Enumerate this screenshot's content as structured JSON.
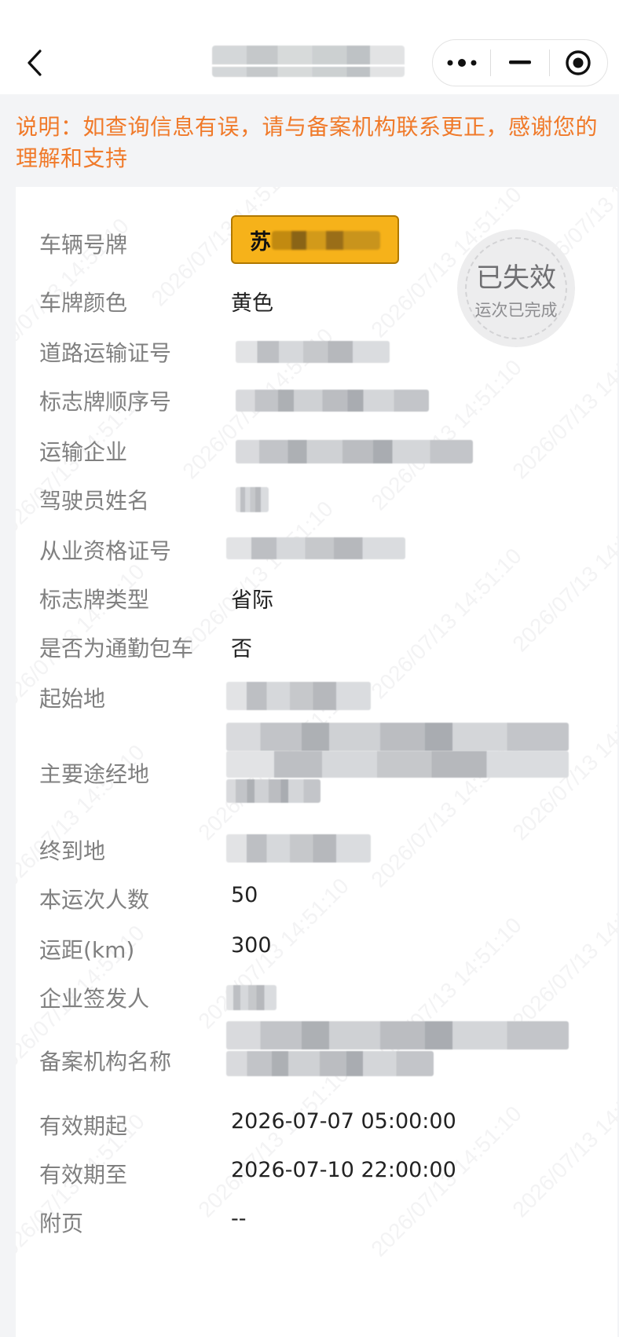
{
  "header": {
    "back_icon": "chevron-left-icon",
    "capsule": {
      "more_icon": "more-dots-icon",
      "minimize_icon": "minimize-icon",
      "close_icon": "target-circle-icon"
    }
  },
  "notice": "说明：如查询信息有误，请与备案机构联系更正，感谢您的理解和支持",
  "stamp": {
    "status": "已失效",
    "substatus": "运次已完成"
  },
  "watermark": "2026/07/13 14:51:10",
  "fields": {
    "plate": {
      "label": "车辆号牌",
      "prefix": "苏"
    },
    "plate_color": {
      "label": "车牌颜色",
      "value": "黄色"
    },
    "road_permit": {
      "label": "道路运输证号"
    },
    "sign_seq": {
      "label": "标志牌顺序号"
    },
    "company": {
      "label": "运输企业"
    },
    "driver": {
      "label": "驾驶员姓名"
    },
    "qualification": {
      "label": "从业资格证号"
    },
    "sign_type": {
      "label": "标志牌类型",
      "value": "省际"
    },
    "commute": {
      "label": "是否为通勤包车",
      "value": "否"
    },
    "origin": {
      "label": "起始地"
    },
    "route": {
      "label": "主要途经地"
    },
    "destination": {
      "label": "终到地"
    },
    "passengers": {
      "label": "本运次人数",
      "value": "50"
    },
    "distance": {
      "label": "运距(km)",
      "value": "300"
    },
    "issuer": {
      "label": "企业签发人"
    },
    "agency": {
      "label": "备案机构名称"
    },
    "valid_from": {
      "label": "有效期起",
      "value": "2026-07-07 05:00:00"
    },
    "valid_to": {
      "label": "有效期至",
      "value": "2026-07-10 22:00:00"
    },
    "attachment": {
      "label": "附页",
      "value": "--"
    }
  }
}
